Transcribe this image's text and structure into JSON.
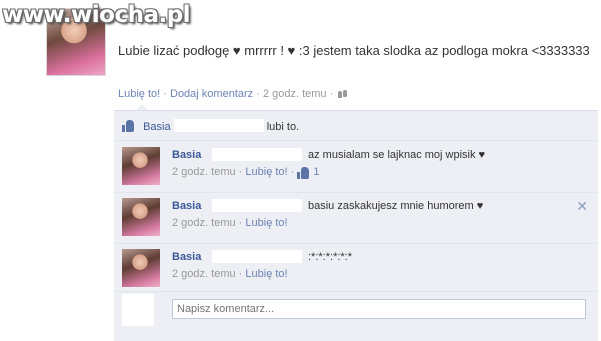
{
  "watermark": "www.wiocha.pl",
  "post": {
    "text": "Lubie lizać podłogę ♥ mrrrrr ! ♥ :3 jestem taka slodka az podloga mokra <3333333",
    "like_link": "Lubię to!",
    "comment_link": "Dodaj komentarz",
    "time": "2 godz. temu",
    "separator": "·",
    "audience_icon": "people-icon"
  },
  "likes": {
    "name": "Basia",
    "suffix": "lubi to."
  },
  "comments": [
    {
      "author": "Basia",
      "text": "az musialam se lajknac moj wpisik ♥",
      "time": "2 godz. temu",
      "like_link": "Lubię to!",
      "like_count": "1"
    },
    {
      "author": "Basia",
      "text": "basiu zaskakujesz mnie humorem ♥",
      "time": "2 godz. temu",
      "like_link": "Lubię to!"
    },
    {
      "author": "Basia",
      "text": ":*:*:*:*:*:*",
      "time": "2 godz. temu",
      "like_link": "Lubię to!"
    }
  ],
  "comment_input": {
    "placeholder": "Napisz komentarz..."
  },
  "colors": {
    "link": "#3b5998",
    "meta_link": "#6d84b4",
    "comments_bg": "#edeff4"
  }
}
